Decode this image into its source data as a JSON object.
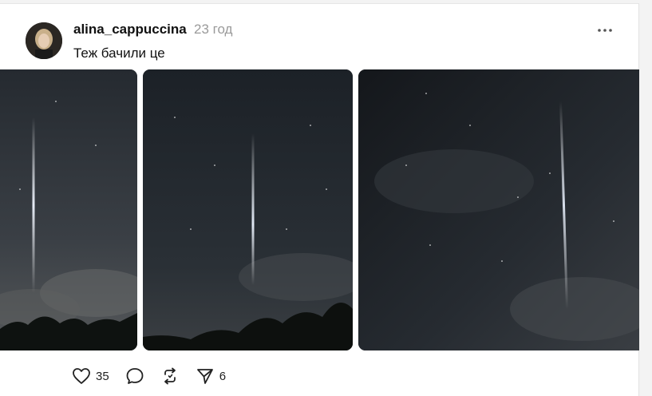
{
  "post": {
    "author": "alina_cappuccina",
    "time": "23 год",
    "text": "Теж бачили це",
    "menu_icon": "more-dots-icon"
  },
  "actions": {
    "likes": "35",
    "reposts": "",
    "shares": "6",
    "icons": [
      "heart-icon",
      "comment-icon",
      "repost-icon",
      "share-icon"
    ]
  },
  "colors": {
    "text": "#111111",
    "muted": "#9a9a9a",
    "sky": "#1c2128"
  }
}
